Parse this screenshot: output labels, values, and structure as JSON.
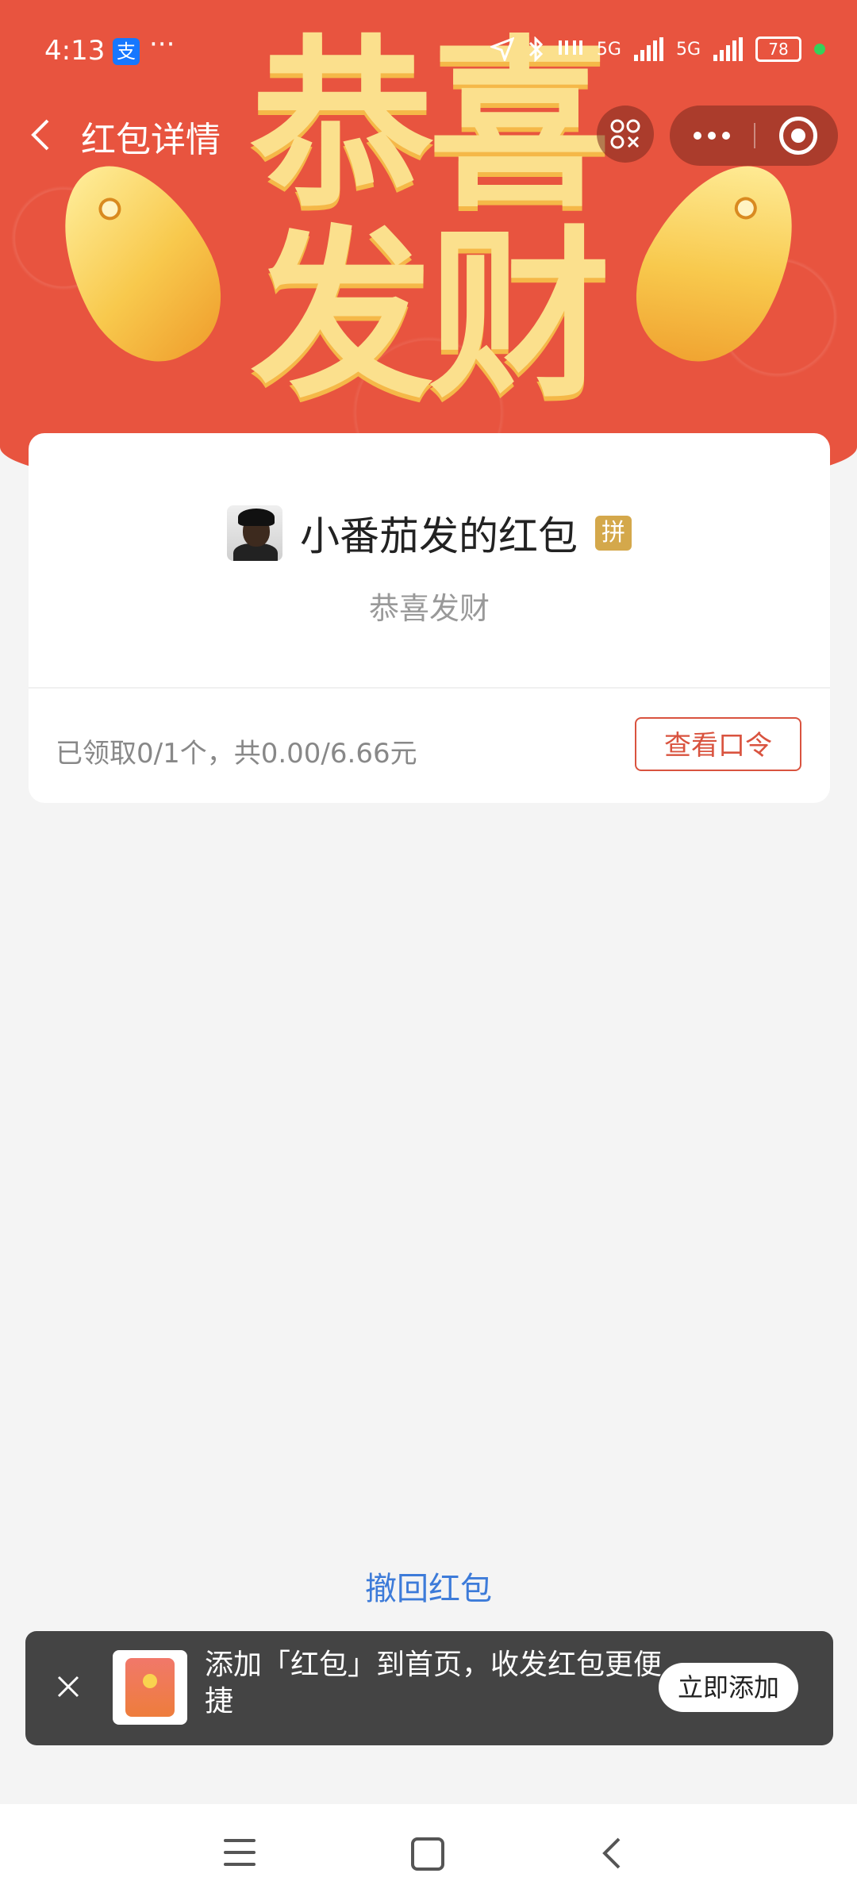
{
  "status_bar": {
    "time": "4:13",
    "alipay_badge": "支",
    "dots": "···",
    "network1": "5G",
    "network2": "5G",
    "battery": "78"
  },
  "nav": {
    "title": "红包详情"
  },
  "banner": {
    "line1": "恭喜",
    "line2": "发财"
  },
  "card": {
    "sender_title": "小番茄发的红包",
    "badge": "拼",
    "greeting": "恭喜发财",
    "received": "已领取0/1个，共0.00/6.66元",
    "view_code_button": "查看口令"
  },
  "bottom": {
    "recall_link": "撤回红包"
  },
  "toast": {
    "message": "添加「红包」到首页，收发红包更便捷",
    "button": "立即添加"
  },
  "colors": {
    "banner_red": "#e8543f",
    "gold": "#fbe08d",
    "link_blue": "#3d7bd9",
    "accent_red": "#d9533f"
  }
}
